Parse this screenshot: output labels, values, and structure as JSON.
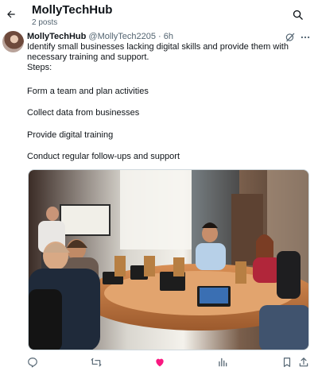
{
  "header": {
    "title": "MollyTechHub",
    "posts": "2 posts"
  },
  "tweet": {
    "author": "MollyTechHub",
    "handle_time": "@MollyTech2205 · 6h",
    "intro": "Identify small businesses lacking digital skills and provide them with necessary training and support.",
    "steps_label": "Steps:",
    "steps": [
      "Form a team and plan activities",
      "Collect data from businesses",
      "Provide digital training",
      "Conduct regular follow-ups and support"
    ]
  },
  "icons": {
    "back": "arrow-left-icon",
    "search": "search-icon",
    "grok": "grok-icon",
    "more": "more-icon",
    "reply": "reply-icon",
    "retweet": "retweet-icon",
    "like": "like-icon",
    "views": "views-icon",
    "bookmark": "bookmark-icon",
    "share": "share-icon"
  },
  "colors": {
    "text": "#0f1419",
    "secondary": "#536471",
    "like_active": "#f91880"
  }
}
